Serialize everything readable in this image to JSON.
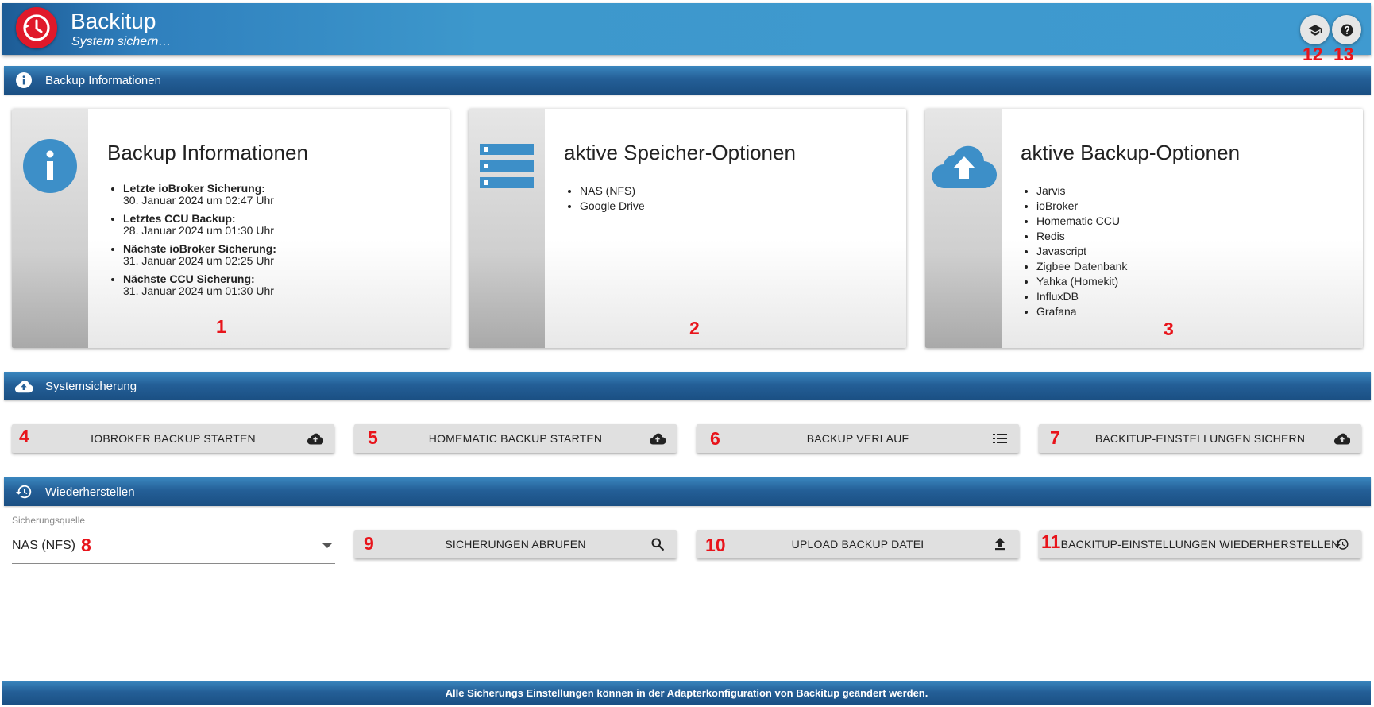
{
  "header": {
    "title": "Backitup",
    "subtitle": "System sichern…",
    "icons": {
      "logo": "clock-backup-icon",
      "tutorial": "graduation-cap-icon",
      "help": "help-icon"
    }
  },
  "sections": {
    "info": {
      "title": "Backup Informationen",
      "icon": "info-icon"
    },
    "backup": {
      "title": "Systemsicherung",
      "icon": "cloud-upload-icon"
    },
    "restore": {
      "title": "Wiederherstellen",
      "icon": "restore-icon"
    }
  },
  "cards": {
    "info": {
      "title": "Backup Informationen",
      "icon": "info-icon",
      "items": [
        {
          "label": "Letzte ioBroker Sicherung:",
          "value": "30. Januar 2024 um 02:47 Uhr"
        },
        {
          "label": "Letztes CCU Backup:",
          "value": "28. Januar 2024 um 01:30 Uhr"
        },
        {
          "label": "Nächste ioBroker Sicherung:",
          "value": "31. Januar 2024 um 02:25 Uhr"
        },
        {
          "label": "Nächste CCU Sicherung:",
          "value": "31. Januar 2024 um 01:30 Uhr"
        }
      ]
    },
    "storage": {
      "title": "aktive Speicher-Optionen",
      "icon": "storage-list-icon",
      "items": [
        "NAS (NFS)",
        "Google Drive"
      ]
    },
    "options": {
      "title": "aktive Backup-Optionen",
      "icon": "cloud-upload-icon",
      "items": [
        "Jarvis",
        "ioBroker",
        "Homematic CCU",
        "Redis",
        "Javascript",
        "Zigbee Datenbank",
        "Yahka (Homekit)",
        "InfluxDB",
        "Grafana"
      ]
    }
  },
  "buttons": {
    "iobroker_backup": "IOBROKER BACKUP STARTEN",
    "homematic_backup": "HOMEMATIC BACKUP STARTEN",
    "backup_history": "BACKUP VERLAUF",
    "save_settings": "BACKITUP-EINSTELLUNGEN SICHERN",
    "fetch_backups": "SICHERUNGEN ABRUFEN",
    "upload_backup": "UPLOAD BACKUP DATEI",
    "restore_settings": "BACKITUP-EINSTELLUNGEN WIEDERHERSTELLEN"
  },
  "restore": {
    "source_label": "Sicherungsquelle",
    "source_value": "NAS (NFS)"
  },
  "callouts": [
    "1",
    "2",
    "3",
    "4",
    "5",
    "6",
    "7",
    "8",
    "9",
    "10",
    "11",
    "12",
    "13"
  ],
  "footer": {
    "text": "Alle Sicherungs Einstellungen können in der Adapterkonfiguration von Backitup geändert werden."
  },
  "colors": {
    "header": "#3f9ad0",
    "section": "#245f97",
    "logo": "#e0192a",
    "icon_blue": "#3d8fc8",
    "callout": "#e8141b"
  }
}
